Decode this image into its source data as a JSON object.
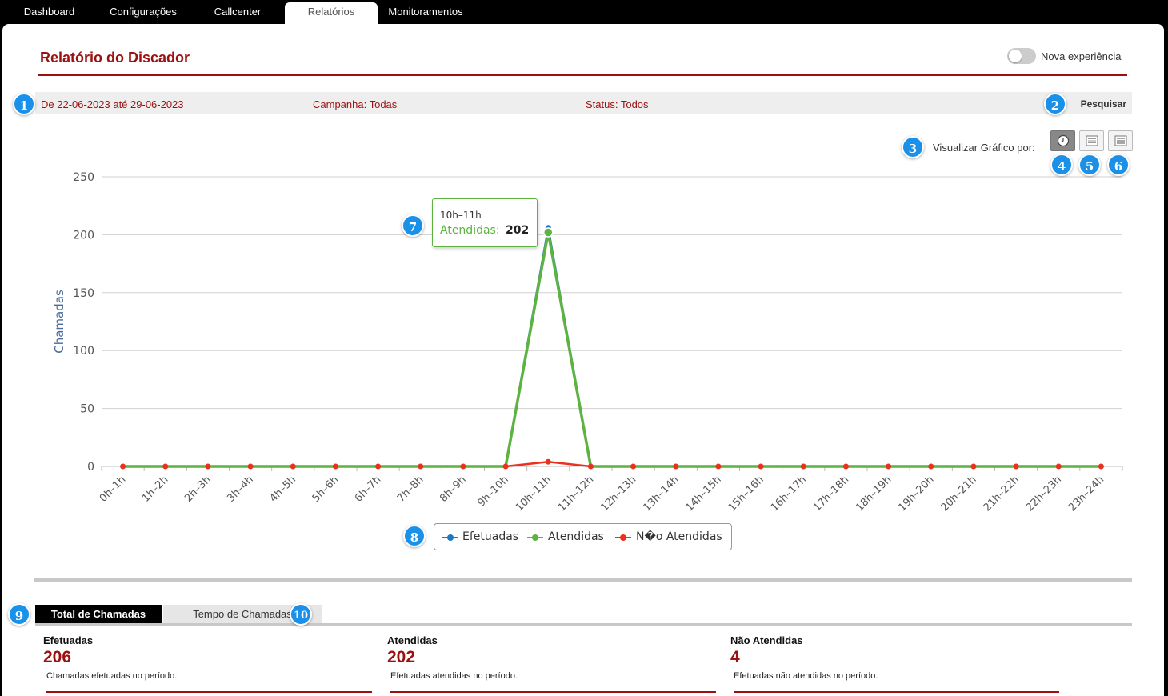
{
  "nav": {
    "tabs": [
      {
        "label": "Dashboard"
      },
      {
        "label": "Configurações"
      },
      {
        "label": "Callcenter"
      },
      {
        "label": "Relatórios"
      },
      {
        "label": "Monitoramentos"
      }
    ],
    "active": "Relatórios"
  },
  "page": {
    "title": "Relatório do Discador",
    "toggle_label": "Nova experiência",
    "toggle_on": false
  },
  "filters": {
    "date_range": "De 22-06-2023 até 29-06-2023",
    "campaign": "Campanha: Todas",
    "status": "Status: Todos",
    "search_label": "Pesquisar"
  },
  "view": {
    "label": "Visualizar Gráfico por:",
    "icons": [
      "clock-icon",
      "card-list-icon",
      "list-icon"
    ]
  },
  "badges": [
    "1",
    "2",
    "3",
    "4",
    "5",
    "6",
    "7",
    "8",
    "9",
    "10"
  ],
  "chart_data": {
    "type": "line",
    "ylabel": "Chamadas",
    "ylim": [
      0,
      250
    ],
    "yticks": [
      0,
      50,
      100,
      150,
      200,
      250
    ],
    "categories": [
      "0h–1h",
      "1h–2h",
      "2h–3h",
      "3h–4h",
      "4h–5h",
      "5h–6h",
      "6h–7h",
      "7h–8h",
      "8h–9h",
      "9h–10h",
      "10h–11h",
      "11h–12h",
      "12h–13h",
      "13h–14h",
      "14h–15h",
      "15h–16h",
      "16h–17h",
      "17h–18h",
      "18h–19h",
      "19h–20h",
      "20h–21h",
      "21h–22h",
      "22h–23h",
      "23h–24h"
    ],
    "series": [
      {
        "name": "Efetuadas",
        "color": "#1f78c1",
        "values": [
          0,
          0,
          0,
          0,
          0,
          0,
          0,
          0,
          0,
          0,
          206,
          0,
          0,
          0,
          0,
          0,
          0,
          0,
          0,
          0,
          0,
          0,
          0,
          0
        ]
      },
      {
        "name": "Atendidas",
        "color": "#5cb340",
        "values": [
          0,
          0,
          0,
          0,
          0,
          0,
          0,
          0,
          0,
          0,
          202,
          0,
          0,
          0,
          0,
          0,
          0,
          0,
          0,
          0,
          0,
          0,
          0,
          0
        ]
      },
      {
        "name": "N�o Atendidas",
        "color": "#e8321e",
        "values": [
          0,
          0,
          0,
          0,
          0,
          0,
          0,
          0,
          0,
          0,
          4,
          0,
          0,
          0,
          0,
          0,
          0,
          0,
          0,
          0,
          0,
          0,
          0,
          0
        ]
      }
    ],
    "tooltip": {
      "title": "10h–11h",
      "series": "Atendidas",
      "value": "202"
    },
    "legend_position": "bottom-center",
    "grid": true
  },
  "bottom_tabs": {
    "active": "Total de Chamadas",
    "inactive": "Tempo de Chamadas"
  },
  "stats": [
    {
      "label": "Efetuadas",
      "value": "206",
      "desc": "Chamadas efetuadas no período."
    },
    {
      "label": "Atendidas",
      "value": "202",
      "desc": "Efetuadas atendidas no período."
    },
    {
      "label": "Não Atendidas",
      "value": "4",
      "desc": "Efetuadas não atendidas no período."
    }
  ],
  "colors": {
    "accent": "#9b1111",
    "badge": "#1a90e8"
  }
}
